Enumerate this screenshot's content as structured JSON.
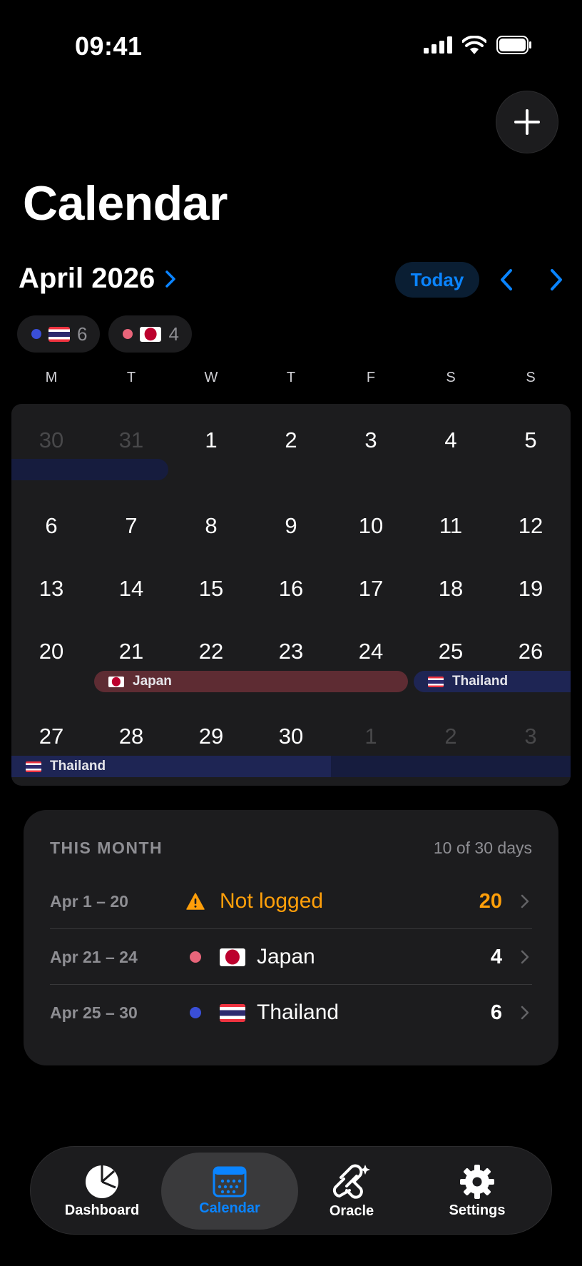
{
  "status_bar": {
    "time": "09:41"
  },
  "page": {
    "title": "Calendar"
  },
  "month_header": {
    "label": "April 2026",
    "today_label": "Today"
  },
  "chips": [
    {
      "dot_color": "#3a4fd8",
      "flag": "thailand-flag",
      "count": "6"
    },
    {
      "dot_color": "#e8657a",
      "flag": "japan-flag",
      "count": "4"
    }
  ],
  "weekdays": [
    "M",
    "T",
    "W",
    "T",
    "F",
    "S",
    "S"
  ],
  "weeks": [
    [
      "30",
      "31",
      "1",
      "2",
      "3",
      "4",
      "5"
    ],
    [
      "6",
      "7",
      "8",
      "9",
      "10",
      "11",
      "12"
    ],
    [
      "13",
      "14",
      "15",
      "16",
      "17",
      "18",
      "19"
    ],
    [
      "20",
      "21",
      "22",
      "23",
      "24",
      "25",
      "26"
    ],
    [
      "27",
      "28",
      "29",
      "30",
      "1",
      "2",
      "3"
    ]
  ],
  "events": {
    "japan": "Japan",
    "thailand_week4": "Thailand",
    "thailand_week5": "Thailand"
  },
  "this_month": {
    "title": "THIS MONTH",
    "summary": "10 of 30 days",
    "rows": [
      {
        "range": "Apr 1 – 20",
        "name": "Not logged",
        "count": "20",
        "color": "#ff9f0a"
      },
      {
        "range": "Apr 21 – 24",
        "name": "Japan",
        "count": "4",
        "color": "#e8657a"
      },
      {
        "range": "Apr 25 – 30",
        "name": "Thailand",
        "count": "6",
        "color": "#3a4fd8"
      }
    ]
  },
  "tabs": [
    {
      "label": "Dashboard",
      "icon": "pie-chart-icon"
    },
    {
      "label": "Calendar",
      "icon": "calendar-icon"
    },
    {
      "label": "Oracle",
      "icon": "oracle-icon"
    },
    {
      "label": "Settings",
      "icon": "gear-icon"
    }
  ],
  "colors": {
    "accent": "#0a84ff",
    "warning": "#ff9f0a",
    "japan": "#e8657a",
    "thailand": "#3a4fd8",
    "background": "#000000",
    "card": "#1c1c1e"
  }
}
